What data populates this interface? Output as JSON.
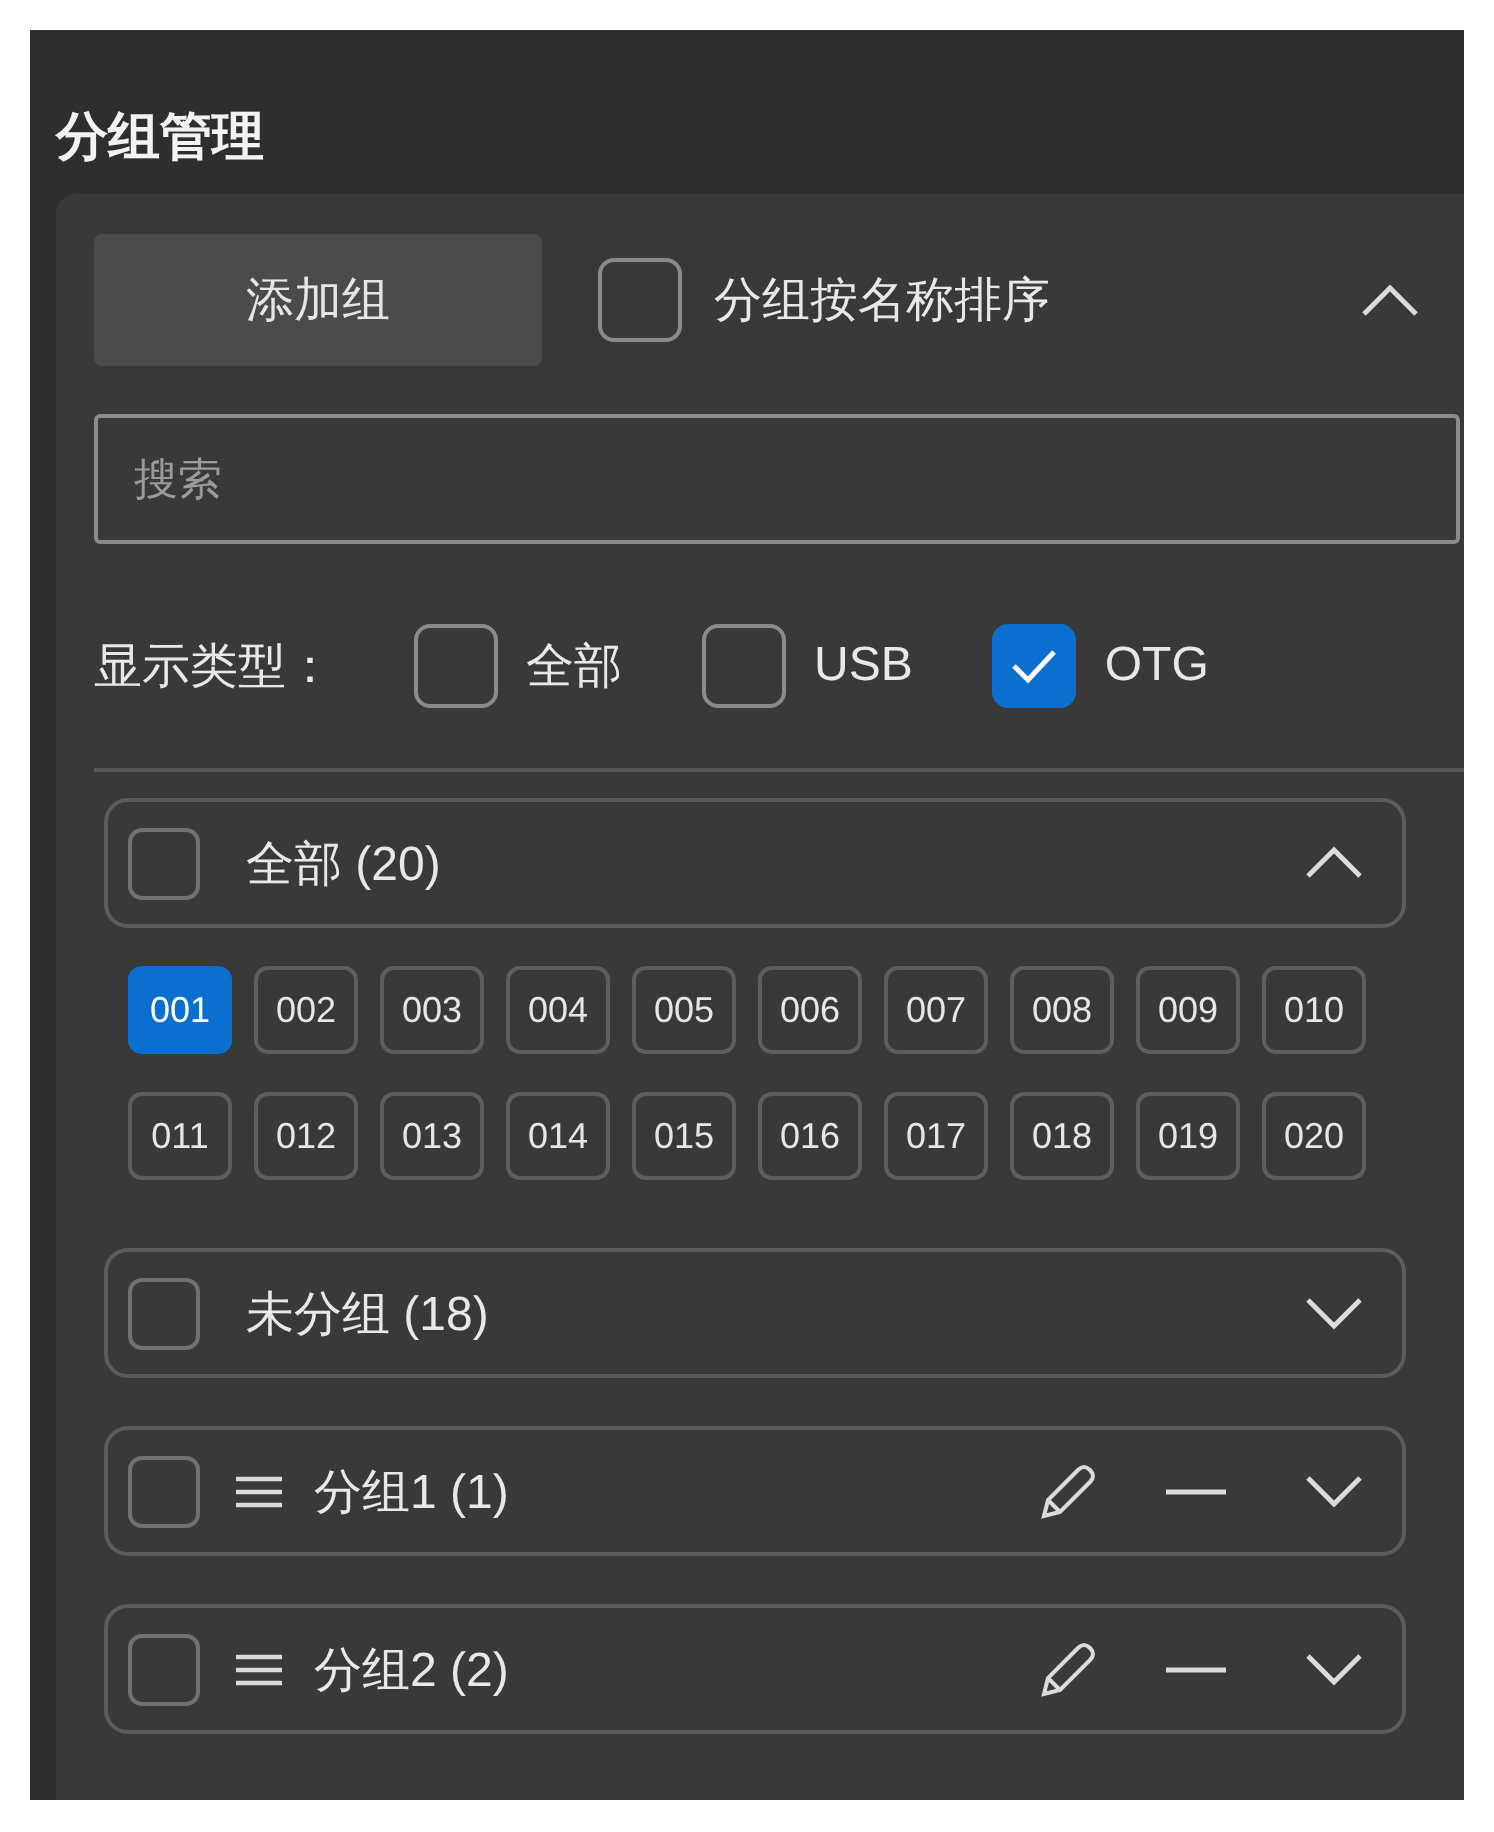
{
  "panel": {
    "title": "分组管理"
  },
  "toolbar": {
    "add_button": "添加组",
    "sort_by_name": {
      "label": "分组按名称排序",
      "checked": false
    },
    "expanded": true
  },
  "search": {
    "placeholder": "搜索"
  },
  "display_type": {
    "label": "显示类型：",
    "options": [
      {
        "label": "全部",
        "checked": false
      },
      {
        "label": "USB",
        "checked": false
      },
      {
        "label": "OTG",
        "checked": true
      }
    ]
  },
  "groups": [
    {
      "kind": "all",
      "label": "全部 (20)",
      "checked": false,
      "expanded": true,
      "devices": [
        {
          "label": "001",
          "selected": true
        },
        {
          "label": "002",
          "selected": false
        },
        {
          "label": "003",
          "selected": false
        },
        {
          "label": "004",
          "selected": false
        },
        {
          "label": "005",
          "selected": false
        },
        {
          "label": "006",
          "selected": false
        },
        {
          "label": "007",
          "selected": false
        },
        {
          "label": "008",
          "selected": false
        },
        {
          "label": "009",
          "selected": false
        },
        {
          "label": "010",
          "selected": false
        },
        {
          "label": "011",
          "selected": false
        },
        {
          "label": "012",
          "selected": false
        },
        {
          "label": "013",
          "selected": false
        },
        {
          "label": "014",
          "selected": false
        },
        {
          "label": "015",
          "selected": false
        },
        {
          "label": "016",
          "selected": false
        },
        {
          "label": "017",
          "selected": false
        },
        {
          "label": "018",
          "selected": false
        },
        {
          "label": "019",
          "selected": false
        },
        {
          "label": "020",
          "selected": false
        }
      ]
    },
    {
      "kind": "ungrouped",
      "label": "未分组 (18)",
      "checked": false,
      "expanded": false
    },
    {
      "kind": "custom",
      "label": "分组1 (1)",
      "checked": false,
      "expanded": false
    },
    {
      "kind": "custom",
      "label": "分组2 (2)",
      "checked": false,
      "expanded": false
    }
  ]
}
